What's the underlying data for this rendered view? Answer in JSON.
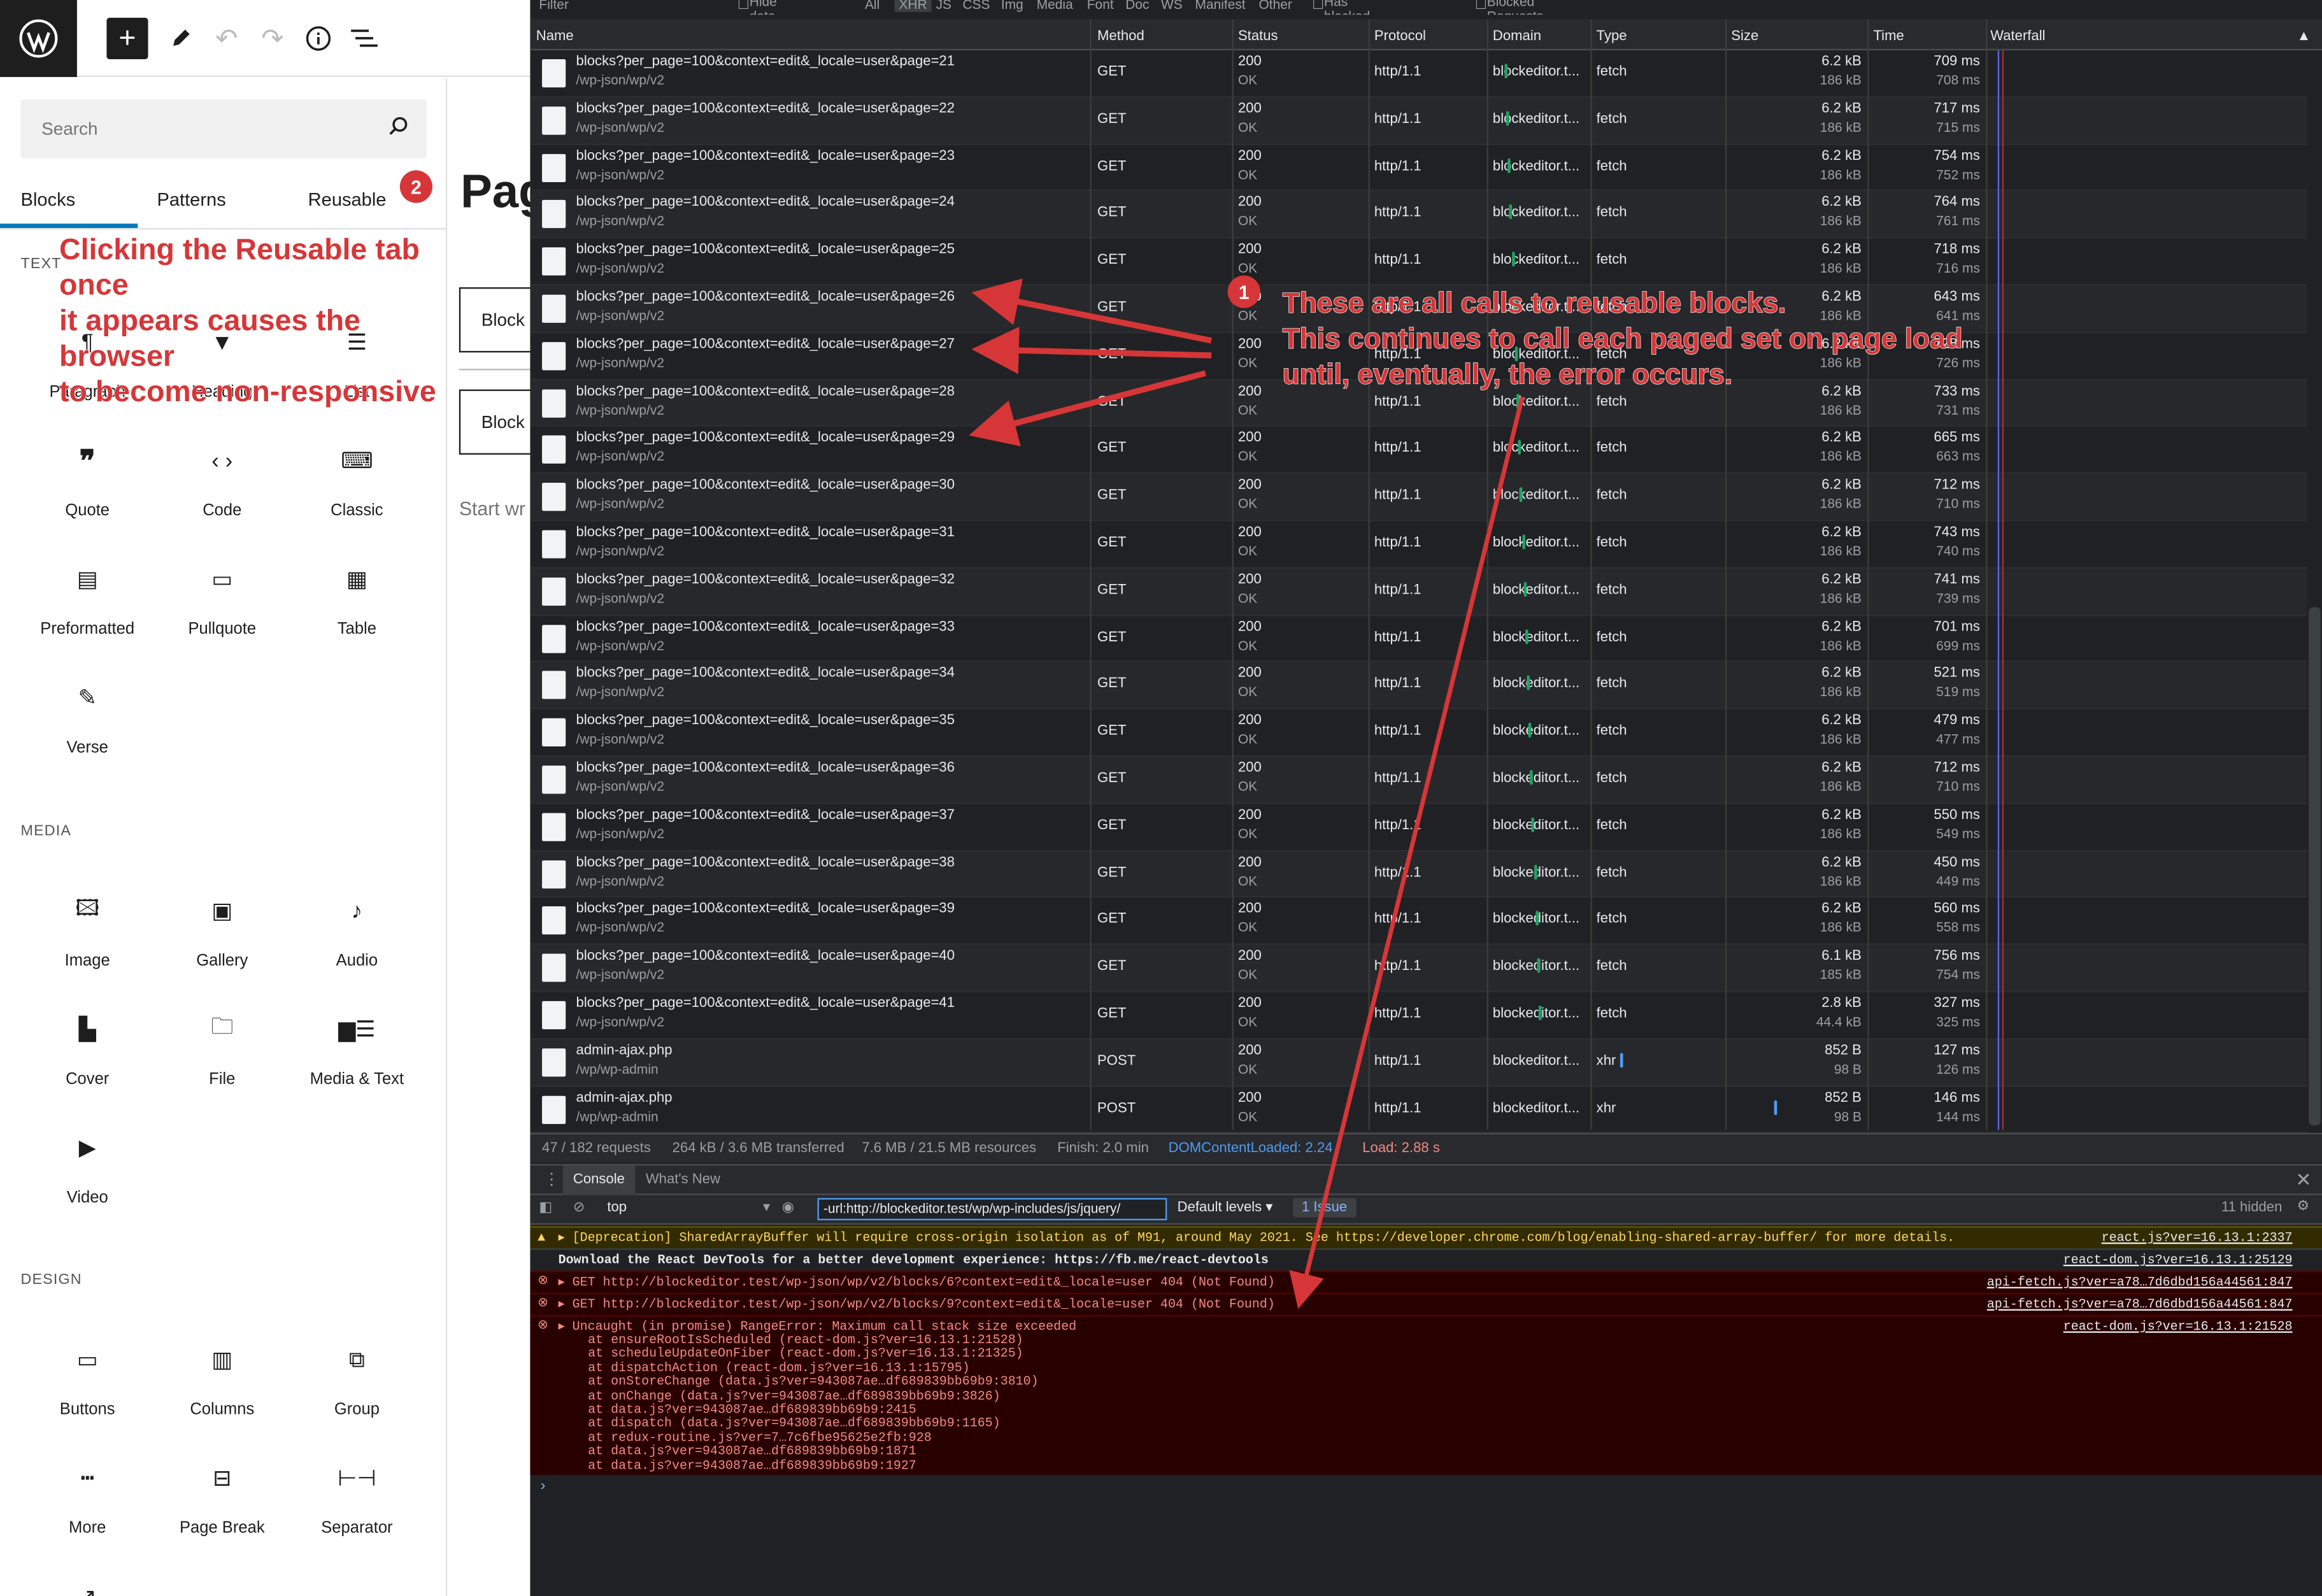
{
  "wp": {
    "search_placeholder": "Search",
    "tabs": [
      "Blocks",
      "Patterns",
      "Reusable"
    ],
    "categories": {
      "text": "TEXT",
      "media": "MEDIA",
      "design": "DESIGN"
    },
    "text_blocks": [
      "Paragraph",
      "Heading",
      "List",
      "Quote",
      "Code",
      "Classic",
      "Preformatted",
      "Pullquote",
      "Table",
      "Verse"
    ],
    "media_blocks": [
      "Image",
      "Gallery",
      "Audio",
      "Cover",
      "File",
      "Media & Text",
      "Video"
    ],
    "design_blocks": [
      "Buttons",
      "Columns",
      "Group",
      "More",
      "Page Break",
      "Separator"
    ],
    "canvas": {
      "title": "Pag",
      "block1": "Block",
      "block2": "Block",
      "start": "Start wr"
    }
  },
  "annotations": {
    "badge1": "1",
    "badge2": "2",
    "left_note": [
      "Clicking the Reusable tab once",
      "it appears causes the browser",
      "to become non-responsive"
    ],
    "right_note": [
      "These are all calls to reusable blocks.",
      "This continues to call each paged set on page load",
      "until, eventually, the error occurs."
    ]
  },
  "devtools": {
    "filter": {
      "placeholder": "Filter",
      "hide_data_urls": "Hide data URLs",
      "types": [
        "All",
        "XHR",
        "JS",
        "CSS",
        "Img",
        "Media",
        "Font",
        "Doc",
        "WS",
        "Manifest",
        "Other"
      ],
      "blocked_cookies": "Has blocked cookies",
      "blocked_requests": "Blocked Requests"
    },
    "columns": [
      "Name",
      "Method",
      "Status",
      "Protocol",
      "Domain",
      "Type",
      "Size",
      "Time",
      "Waterfall"
    ],
    "rows": [
      {
        "name": "blocks?per_page=100&context=edit&_locale=user&page=21",
        "path": "/wp-json/wp/v2",
        "method": "GET",
        "status": "200",
        "status_text": "OK",
        "protocol": "http/1.1",
        "domain": "blockeditor.t...",
        "type": "fetch",
        "size": "6.2 kB",
        "size2": "186 kB",
        "time": "709 ms",
        "time2": "708 ms"
      },
      {
        "name": "blocks?per_page=100&context=edit&_locale=user&page=22",
        "path": "/wp-json/wp/v2",
        "method": "GET",
        "status": "200",
        "status_text": "OK",
        "protocol": "http/1.1",
        "domain": "blockeditor.t...",
        "type": "fetch",
        "size": "6.2 kB",
        "size2": "186 kB",
        "time": "717 ms",
        "time2": "715 ms"
      },
      {
        "name": "blocks?per_page=100&context=edit&_locale=user&page=23",
        "path": "/wp-json/wp/v2",
        "method": "GET",
        "status": "200",
        "status_text": "OK",
        "protocol": "http/1.1",
        "domain": "blockeditor.t...",
        "type": "fetch",
        "size": "6.2 kB",
        "size2": "186 kB",
        "time": "754 ms",
        "time2": "752 ms"
      },
      {
        "name": "blocks?per_page=100&context=edit&_locale=user&page=24",
        "path": "/wp-json/wp/v2",
        "method": "GET",
        "status": "200",
        "status_text": "OK",
        "protocol": "http/1.1",
        "domain": "blockeditor.t...",
        "type": "fetch",
        "size": "6.2 kB",
        "size2": "186 kB",
        "time": "764 ms",
        "time2": "761 ms"
      },
      {
        "name": "blocks?per_page=100&context=edit&_locale=user&page=25",
        "path": "/wp-json/wp/v2",
        "method": "GET",
        "status": "200",
        "status_text": "OK",
        "protocol": "http/1.1",
        "domain": "blockeditor.t...",
        "type": "fetch",
        "size": "6.2 kB",
        "size2": "186 kB",
        "time": "718 ms",
        "time2": "716 ms"
      },
      {
        "name": "blocks?per_page=100&context=edit&_locale=user&page=26",
        "path": "/wp-json/wp/v2",
        "method": "GET",
        "status": "200",
        "status_text": "OK",
        "protocol": "http/1.1",
        "domain": "blockeditor.t...",
        "type": "fetch",
        "size": "6.2 kB",
        "size2": "186 kB",
        "time": "643 ms",
        "time2": "641 ms"
      },
      {
        "name": "blocks?per_page=100&context=edit&_locale=user&page=27",
        "path": "/wp-json/wp/v2",
        "method": "GET",
        "status": "200",
        "status_text": "OK",
        "protocol": "http/1.1",
        "domain": "blockeditor.t...",
        "type": "fetch",
        "size": "6.2 kB",
        "size2": "186 kB",
        "time": "728 ms",
        "time2": "726 ms"
      },
      {
        "name": "blocks?per_page=100&context=edit&_locale=user&page=28",
        "path": "/wp-json/wp/v2",
        "method": "GET",
        "status": "200",
        "status_text": "OK",
        "protocol": "http/1.1",
        "domain": "blockeditor.t...",
        "type": "fetch",
        "size": "6.2 kB",
        "size2": "186 kB",
        "time": "733 ms",
        "time2": "731 ms"
      },
      {
        "name": "blocks?per_page=100&context=edit&_locale=user&page=29",
        "path": "/wp-json/wp/v2",
        "method": "GET",
        "status": "200",
        "status_text": "OK",
        "protocol": "http/1.1",
        "domain": "blockeditor.t...",
        "type": "fetch",
        "size": "6.2 kB",
        "size2": "186 kB",
        "time": "665 ms",
        "time2": "663 ms"
      },
      {
        "name": "blocks?per_page=100&context=edit&_locale=user&page=30",
        "path": "/wp-json/wp/v2",
        "method": "GET",
        "status": "200",
        "status_text": "OK",
        "protocol": "http/1.1",
        "domain": "blockeditor.t...",
        "type": "fetch",
        "size": "6.2 kB",
        "size2": "186 kB",
        "time": "712 ms",
        "time2": "710 ms"
      },
      {
        "name": "blocks?per_page=100&context=edit&_locale=user&page=31",
        "path": "/wp-json/wp/v2",
        "method": "GET",
        "status": "200",
        "status_text": "OK",
        "protocol": "http/1.1",
        "domain": "blockeditor.t...",
        "type": "fetch",
        "size": "6.2 kB",
        "size2": "186 kB",
        "time": "743 ms",
        "time2": "740 ms"
      },
      {
        "name": "blocks?per_page=100&context=edit&_locale=user&page=32",
        "path": "/wp-json/wp/v2",
        "method": "GET",
        "status": "200",
        "status_text": "OK",
        "protocol": "http/1.1",
        "domain": "blockeditor.t...",
        "type": "fetch",
        "size": "6.2 kB",
        "size2": "186 kB",
        "time": "741 ms",
        "time2": "739 ms"
      },
      {
        "name": "blocks?per_page=100&context=edit&_locale=user&page=33",
        "path": "/wp-json/wp/v2",
        "method": "GET",
        "status": "200",
        "status_text": "OK",
        "protocol": "http/1.1",
        "domain": "blockeditor.t...",
        "type": "fetch",
        "size": "6.2 kB",
        "size2": "186 kB",
        "time": "701 ms",
        "time2": "699 ms"
      },
      {
        "name": "blocks?per_page=100&context=edit&_locale=user&page=34",
        "path": "/wp-json/wp/v2",
        "method": "GET",
        "status": "200",
        "status_text": "OK",
        "protocol": "http/1.1",
        "domain": "blockeditor.t...",
        "type": "fetch",
        "size": "6.2 kB",
        "size2": "186 kB",
        "time": "521 ms",
        "time2": "519 ms"
      },
      {
        "name": "blocks?per_page=100&context=edit&_locale=user&page=35",
        "path": "/wp-json/wp/v2",
        "method": "GET",
        "status": "200",
        "status_text": "OK",
        "protocol": "http/1.1",
        "domain": "blockeditor.t...",
        "type": "fetch",
        "size": "6.2 kB",
        "size2": "186 kB",
        "time": "479 ms",
        "time2": "477 ms"
      },
      {
        "name": "blocks?per_page=100&context=edit&_locale=user&page=36",
        "path": "/wp-json/wp/v2",
        "method": "GET",
        "status": "200",
        "status_text": "OK",
        "protocol": "http/1.1",
        "domain": "blockeditor.t...",
        "type": "fetch",
        "size": "6.2 kB",
        "size2": "186 kB",
        "time": "712 ms",
        "time2": "710 ms"
      },
      {
        "name": "blocks?per_page=100&context=edit&_locale=user&page=37",
        "path": "/wp-json/wp/v2",
        "method": "GET",
        "status": "200",
        "status_text": "OK",
        "protocol": "http/1.1",
        "domain": "blockeditor.t...",
        "type": "fetch",
        "size": "6.2 kB",
        "size2": "186 kB",
        "time": "550 ms",
        "time2": "549 ms"
      },
      {
        "name": "blocks?per_page=100&context=edit&_locale=user&page=38",
        "path": "/wp-json/wp/v2",
        "method": "GET",
        "status": "200",
        "status_text": "OK",
        "protocol": "http/1.1",
        "domain": "blockeditor.t...",
        "type": "fetch",
        "size": "6.2 kB",
        "size2": "186 kB",
        "time": "450 ms",
        "time2": "449 ms"
      },
      {
        "name": "blocks?per_page=100&context=edit&_locale=user&page=39",
        "path": "/wp-json/wp/v2",
        "method": "GET",
        "status": "200",
        "status_text": "OK",
        "protocol": "http/1.1",
        "domain": "blockeditor.t...",
        "type": "fetch",
        "size": "6.2 kB",
        "size2": "186 kB",
        "time": "560 ms",
        "time2": "558 ms"
      },
      {
        "name": "blocks?per_page=100&context=edit&_locale=user&page=40",
        "path": "/wp-json/wp/v2",
        "method": "GET",
        "status": "200",
        "status_text": "OK",
        "protocol": "http/1.1",
        "domain": "blockeditor.t...",
        "type": "fetch",
        "size": "6.1 kB",
        "size2": "185 kB",
        "time": "756 ms",
        "time2": "754 ms"
      },
      {
        "name": "blocks?per_page=100&context=edit&_locale=user&page=41",
        "path": "/wp-json/wp/v2",
        "method": "GET",
        "status": "200",
        "status_text": "OK",
        "protocol": "http/1.1",
        "domain": "blockeditor.t...",
        "type": "fetch",
        "size": "2.8 kB",
        "size2": "44.4 kB",
        "time": "327 ms",
        "time2": "325 ms"
      },
      {
        "name": "admin-ajax.php",
        "path": "/wp/wp-admin",
        "method": "POST",
        "status": "200",
        "status_text": "OK",
        "protocol": "http/1.1",
        "domain": "blockeditor.t...",
        "type": "xhr",
        "size": "852 B",
        "size2": "98 B",
        "time": "127 ms",
        "time2": "126 ms"
      },
      {
        "name": "admin-ajax.php",
        "path": "/wp/wp-admin",
        "method": "POST",
        "status": "200",
        "status_text": "OK",
        "protocol": "http/1.1",
        "domain": "blockeditor.t...",
        "type": "xhr",
        "size": "852 B",
        "size2": "98 B",
        "time": "146 ms",
        "time2": "144 ms"
      }
    ],
    "summary": {
      "requests": "47 / 182 requests",
      "transferred": "264 kB / 3.6 MB transferred",
      "resources": "7.6 MB / 21.5 MB resources",
      "finish": "Finish: 2.0 min",
      "dcl": "DOMContentLoaded: 2.24",
      "load": "Load: 2.88 s"
    },
    "console_tabs": [
      "Console",
      "What's New"
    ],
    "console_toolbar": {
      "context": "top",
      "filter": "-url:http://blockeditor.test/wp/wp-includes/js/jquery/",
      "levels": "Default levels",
      "issue": "1 Issue",
      "hidden": "11 hidden"
    },
    "console": {
      "warn": "▸ [Deprecation] SharedArrayBuffer will require cross-origin isolation as of M91, around May 2021. See https://developer.chrome.com/blog/enabling-shared-array-buffer/ for more details.",
      "warn_src": "react.js?ver=16.13.1:2337",
      "info": "Download the React DevTools for a better development experience: https://fb.me/react-devtools",
      "info_src": "react-dom.js?ver=16.13.1:25129",
      "err1": "▸ GET http://blockeditor.test/wp-json/wp/v2/blocks/6?context=edit&_locale=user 404 (Not Found)",
      "err1_src": "api-fetch.js?ver=a78…7d6dbd156a44561:847",
      "err2": "▸ GET http://blockeditor.test/wp-json/wp/v2/blocks/9?context=edit&_locale=user 404 (Not Found)",
      "err2_src": "api-fetch.js?ver=a78…7d6dbd156a44561:847",
      "err3": "▸ Uncaught (in promise) RangeError: Maximum call stack size exceeded",
      "err3_src": "react-dom.js?ver=16.13.1:21528",
      "stack": [
        "at ensureRootIsScheduled (react-dom.js?ver=16.13.1:21528)",
        "at scheduleUpdateOnFiber (react-dom.js?ver=16.13.1:21325)",
        "at dispatchAction (react-dom.js?ver=16.13.1:15795)",
        "at onStoreChange (data.js?ver=943087ae…df689839bb69b9:3810)",
        "at onChange (data.js?ver=943087ae…df689839bb69b9:3826)",
        "at data.js?ver=943087ae…df689839bb69b9:2415",
        "at dispatch (data.js?ver=943087ae…df689839bb69b9:1165)",
        "at redux-routine.js?ver=7…7c6fbe95625e2fb:928",
        "at data.js?ver=943087ae…df689839bb69b9:1871",
        "at data.js?ver=943087ae…df689839bb69b9:1927"
      ]
    }
  },
  "colors": {
    "annotation": "#d63638",
    "wp_accent": "#007cba",
    "devtools_bg": "#202124",
    "error_bg": "#290000"
  }
}
